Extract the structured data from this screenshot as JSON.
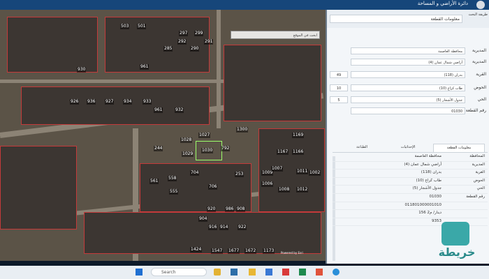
{
  "app": {
    "title": "دائرة الأراضي و المساحة"
  },
  "map": {
    "search_placeholder": "ابحث في الموقع",
    "lots_left": [
      "503",
      "501",
      "297",
      "299",
      "291",
      "292",
      "290",
      "285",
      "961",
      "930",
      "926",
      "936",
      "927",
      "934",
      "933",
      "961",
      "932",
      "1028",
      "1027",
      "1030",
      "1029",
      "1300",
      "792",
      "244",
      "561",
      "558",
      "555",
      "706",
      "704",
      "253",
      "986",
      "908",
      "914",
      "922",
      "904",
      "920",
      "916",
      "1424",
      "1547",
      "1677",
      "1672",
      "1173"
    ],
    "lots_right": [
      "1169",
      "1166",
      "1167",
      "1011",
      "1009",
      "1007",
      "1006",
      "1008",
      "1012",
      "1002"
    ],
    "attribution": "Powered by Esri"
  },
  "panel": {
    "main_select": "معلومات القطعة",
    "header_label": "طريقة البحث",
    "form_rows": [
      {
        "label": "المديرية",
        "value": "محافظة العاصمة",
        "box": ""
      },
      {
        "label": "المديرية",
        "value": "أراضي شمال عمان (4)",
        "box": ""
      },
      {
        "label": "القرية",
        "value": "بدران (118)",
        "box": "49"
      },
      {
        "label": "الحوض",
        "value": "طاب كراع (10)",
        "box": "10"
      },
      {
        "label": "الحي",
        "value": "جدول الأشجار (5)",
        "box": "5"
      },
      {
        "label": "رقم القطعة",
        "value": "01030",
        "box": ""
      }
    ],
    "tabs": [
      "معلومات القطعة",
      "الإحداثيات",
      "الطباعة"
    ],
    "results": [
      {
        "label": "المحافظة",
        "value": "محافظة العاصمة"
      },
      {
        "label": "المديرية",
        "value": "أراضي شمال عمان (4)"
      },
      {
        "label": "القرية",
        "value": "بدران (118)"
      },
      {
        "label": "الحوض",
        "value": "طاب كراع (10)"
      },
      {
        "label": "الحي",
        "value": "جدول الأشجار (5)"
      },
      {
        "label": "رقم القطعة",
        "value": "01030"
      },
      {
        "label": "",
        "value": "011801000001010"
      },
      {
        "label": "",
        "value": "156 دينار/ م2"
      },
      {
        "label": "",
        "value": "9353"
      }
    ]
  },
  "taskbar": {
    "search_label": "Search"
  },
  "watermark": {
    "text": "خريطة"
  },
  "colors": {
    "header": "#16467a",
    "accent": "#3aa8a8"
  }
}
